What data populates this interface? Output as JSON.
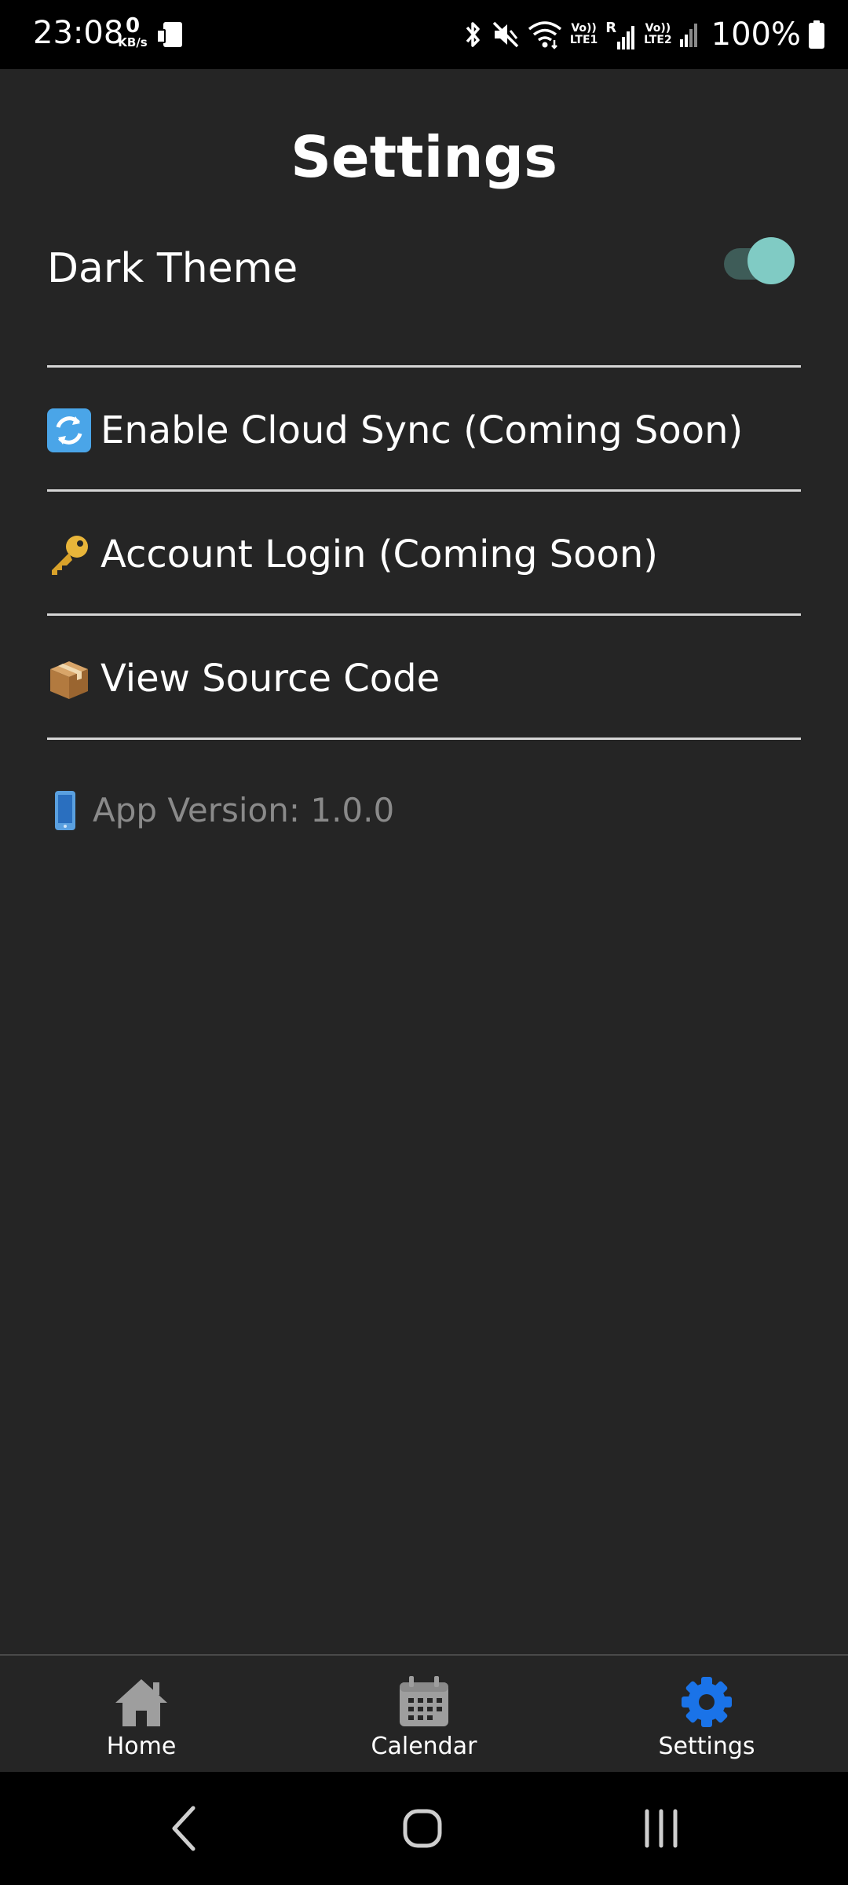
{
  "status_bar": {
    "time": "23:08",
    "net_speed_value": "0",
    "net_speed_unit": "KB/s",
    "lte1_label_top": "Vo))",
    "lte1_label_bottom": "LTE1",
    "roaming": "R",
    "lte2_label_top": "Vo))",
    "lte2_label_bottom": "LTE2",
    "battery": "100%"
  },
  "page": {
    "title": "Settings"
  },
  "settings": {
    "dark_theme_label": "Dark Theme",
    "dark_theme_enabled": true,
    "toggle_colors": {
      "track": "#3e5c58",
      "thumb": "#80cbc4"
    },
    "items": [
      {
        "icon": "sync-arrows-icon",
        "label": "Enable Cloud Sync (Coming Soon)"
      },
      {
        "icon": "key-icon",
        "label": "Account Login (Coming Soon)"
      },
      {
        "icon": "package-icon",
        "label": "View Source Code"
      }
    ],
    "version_icon": "mobile-phone-icon",
    "version_text": "App Version: 1.0.0"
  },
  "tab_bar": {
    "active_color": "#1a73e8",
    "inactive_color": "#9e9e9e",
    "tabs": [
      {
        "icon": "home-icon",
        "label": "Home",
        "active": false
      },
      {
        "icon": "calendar-icon",
        "label": "Calendar",
        "active": false
      },
      {
        "icon": "gear-icon",
        "label": "Settings",
        "active": true
      }
    ]
  },
  "system_nav": {
    "back": "back-icon",
    "home": "home-circle-icon",
    "recents": "recents-icon"
  }
}
